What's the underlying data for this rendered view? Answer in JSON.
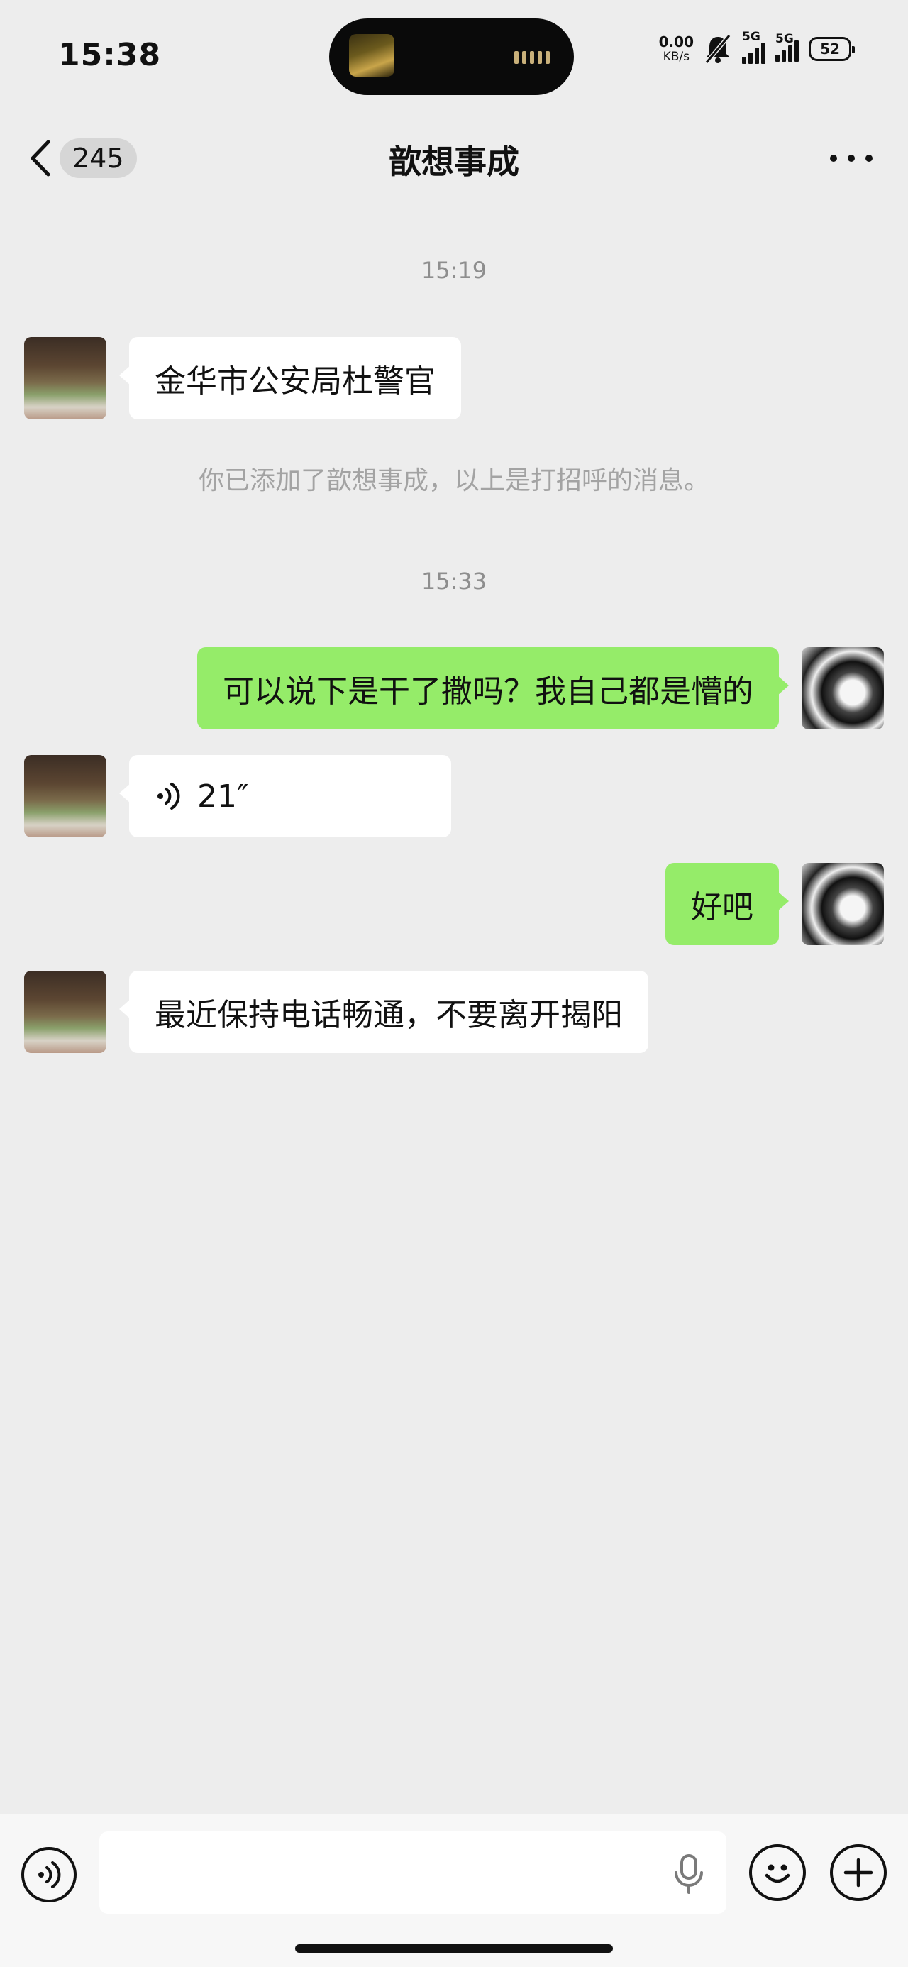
{
  "status_bar": {
    "time": "15:38",
    "net_speed_value": "0.00",
    "net_speed_unit": "KB/s",
    "signal1_label": "5G",
    "signal2_label": "5G",
    "battery_level": "52"
  },
  "header": {
    "unread_count": "245",
    "title": "歆想事成"
  },
  "messages": {
    "time1": "15:19",
    "msg1": "金华市公安局杜警官",
    "system": "你已添加了歆想事成，以上是打招呼的消息。",
    "time2": "15:33",
    "msg2": "可以说下是干了撒吗？我自己都是懵的",
    "voice_duration": "21″",
    "msg3": "好吧",
    "msg4": "最近保持电话畅通，不要离开揭阳"
  },
  "input": {
    "placeholder": ""
  },
  "icons": {
    "back": "chevron-left-icon",
    "more": "more-dots-icon",
    "voice_toggle": "voice-toggle-icon",
    "mic": "microphone-icon",
    "emoji": "emoji-icon",
    "plus": "plus-icon",
    "mute": "bell-muted-icon"
  },
  "colors": {
    "background": "#ededed",
    "outgoing_bubble": "#95ec69",
    "incoming_bubble": "#ffffff",
    "timestamp": "#8e8e8e"
  }
}
